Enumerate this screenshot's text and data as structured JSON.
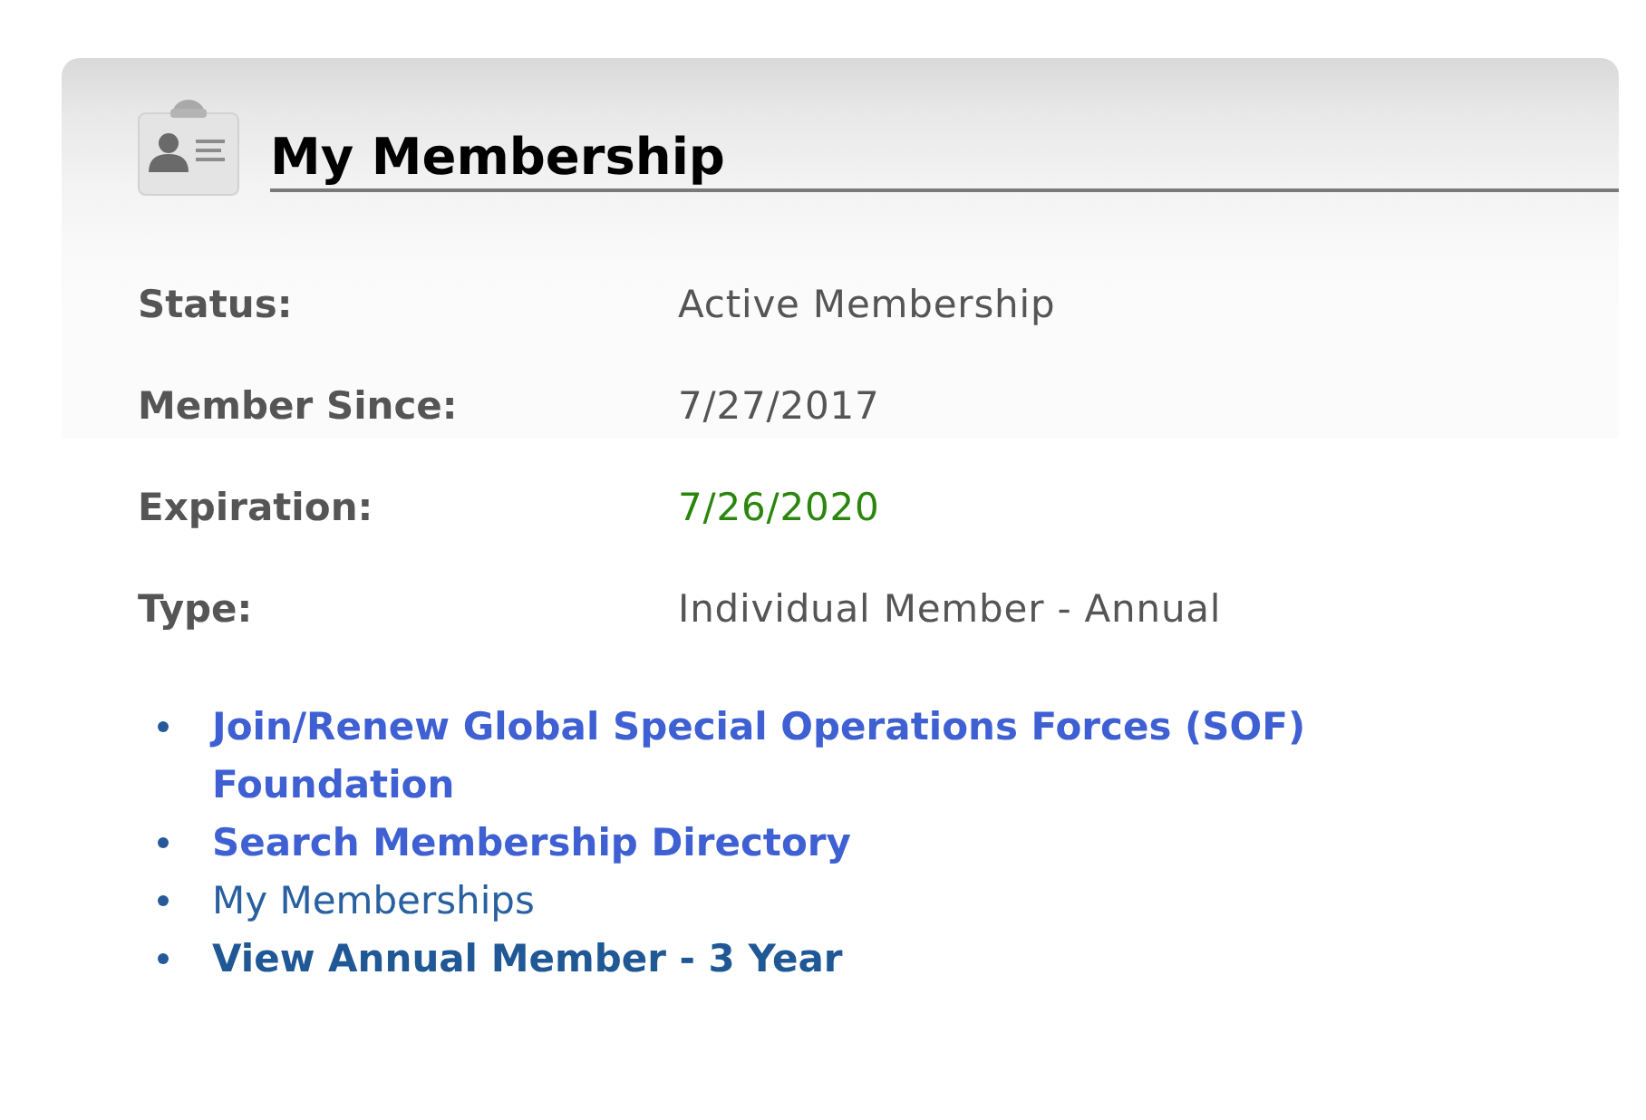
{
  "panel": {
    "title": "My Membership"
  },
  "details": [
    {
      "label": "Status:",
      "value": "Active Membership",
      "color": "#555555"
    },
    {
      "label": "Member Since:",
      "value": "7/27/2017",
      "color": "#555555"
    },
    {
      "label": "Expiration:",
      "value": "7/26/2020",
      "color": "#2a860c"
    },
    {
      "label": "Type:",
      "value": "Individual Member - Annual",
      "color": "#555555"
    }
  ],
  "links": [
    {
      "label": "Join/Renew Global Special Operations Forces (SOF) Foundation",
      "kind": "action"
    },
    {
      "label": "Search Membership Directory",
      "kind": "action"
    },
    {
      "label": "My Memberships",
      "kind": "plain"
    },
    {
      "label": "View Annual Member - 3 Year",
      "kind": "strong"
    }
  ]
}
